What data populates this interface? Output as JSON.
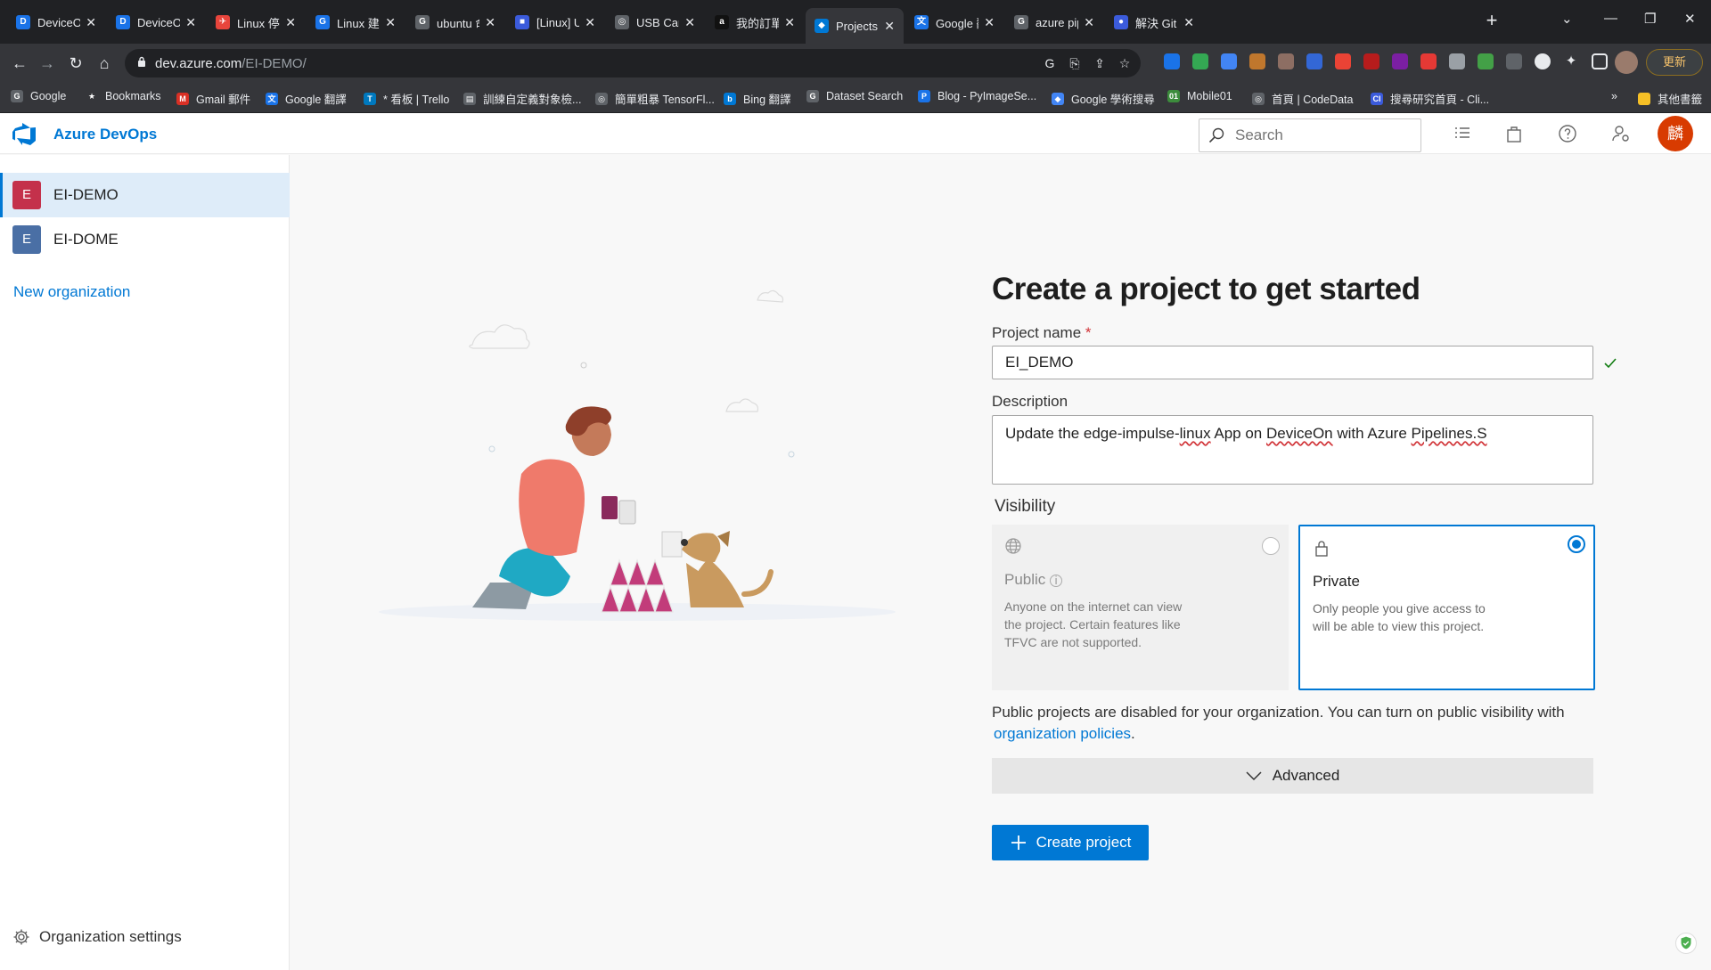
{
  "browser": {
    "tabs": [
      {
        "title": "DeviceOn",
        "favicon": "D",
        "color": "#1a73e8"
      },
      {
        "title": "DeviceOn",
        "favicon": "D",
        "color": "#1a73e8"
      },
      {
        "title": "Linux 停止程",
        "favicon": "✈",
        "color": "#e8453c"
      },
      {
        "title": "Linux 建立自",
        "favicon": "G",
        "color": "#1a73e8"
      },
      {
        "title": "ubuntu 命令",
        "favicon": "G",
        "color": "#5f6368"
      },
      {
        "title": "[Linux] Ubun",
        "favicon": "■",
        "color": "#3b5bdb"
      },
      {
        "title": "USB Camera",
        "favicon": "◎",
        "color": "#5f6368"
      },
      {
        "title": "我的訂單",
        "favicon": "a",
        "color": "#111"
      },
      {
        "title": "Projects - Ho",
        "favicon": "◆",
        "color": "#0078d4"
      },
      {
        "title": "Google 翻譯",
        "favicon": "文",
        "color": "#1a73e8"
      },
      {
        "title": "azure pipelin",
        "favicon": "G",
        "color": "#5f6368"
      },
      {
        "title": "解決 Git Push",
        "favicon": "●",
        "color": "#3b5bdb"
      }
    ],
    "active_tab_index": 8,
    "url_host": "dev.azure.com",
    "url_path": "/EI-DEMO/",
    "update_label": "更新",
    "bookmarks": [
      {
        "label": "Google",
        "icon": "G",
        "color": "#5f6368"
      },
      {
        "label": "Bookmarks",
        "icon": "★",
        "color": "#35363a"
      },
      {
        "label": "Gmail 郵件",
        "icon": "M",
        "color": "#d93025"
      },
      {
        "label": "Google 翻譯",
        "icon": "文",
        "color": "#1a73e8"
      },
      {
        "label": "* 看板 | Trello",
        "icon": "T",
        "color": "#0079bf"
      },
      {
        "label": "訓練自定義對象檢...",
        "icon": "▤",
        "color": "#5f6368"
      },
      {
        "label": "簡單粗暴 TensorFl...",
        "icon": "◎",
        "color": "#5f6368"
      },
      {
        "label": "Bing 翻譯",
        "icon": "b",
        "color": "#0078d4"
      },
      {
        "label": "Dataset Search",
        "icon": "G",
        "color": "#5f6368"
      },
      {
        "label": "Blog - PyImageSe...",
        "icon": "P",
        "color": "#1a73e8"
      },
      {
        "label": "Google 學術搜尋",
        "icon": "◆",
        "color": "#4285f4"
      },
      {
        "label": "Mobile01",
        "icon": "01",
        "color": "#3c8c3c"
      },
      {
        "label": "首頁 | CodeData",
        "icon": "◎",
        "color": "#5f6368"
      },
      {
        "label": "搜尋研究首頁 - Cli...",
        "icon": "CI",
        "color": "#3b5bdb"
      }
    ],
    "other_bookmarks": "其他書籤"
  },
  "app": {
    "brand": "Azure DevOps",
    "search_placeholder": "Search",
    "avatar_initial": "麟",
    "accent": "#0078d4"
  },
  "sidebar": {
    "orgs": [
      {
        "name": "EI-DEMO",
        "initial": "E",
        "color": "#c4314b",
        "selected": true
      },
      {
        "name": "EI-DOME",
        "initial": "E",
        "color": "#4a6fa5",
        "selected": false
      }
    ],
    "new_org_label": "New organization",
    "settings_label": "Organization settings"
  },
  "form": {
    "title": "Create a project to get started",
    "project_name_label": "Project name",
    "required_mark": "*",
    "project_name_value": "EI_DEMO",
    "description_label": "Description",
    "description_parts": [
      "Update the edge-impulse-",
      "linux",
      " App on ",
      "DeviceOn",
      " with Azure ",
      "Pipelines.S"
    ],
    "visibility_label": "Visibility",
    "public": {
      "name": "Public",
      "desc": "Anyone on the internet can view the project. Certain features like TFVC are not supported."
    },
    "private": {
      "name": "Private",
      "desc": "Only people you give access to will be able to view this project."
    },
    "selected_visibility": "Private",
    "note_text": "Public projects are disabled for your organization. You can turn on public visibility with",
    "note_link": "organization policies",
    "note_end": ".",
    "advanced_label": "Advanced",
    "create_label": "Create project"
  }
}
